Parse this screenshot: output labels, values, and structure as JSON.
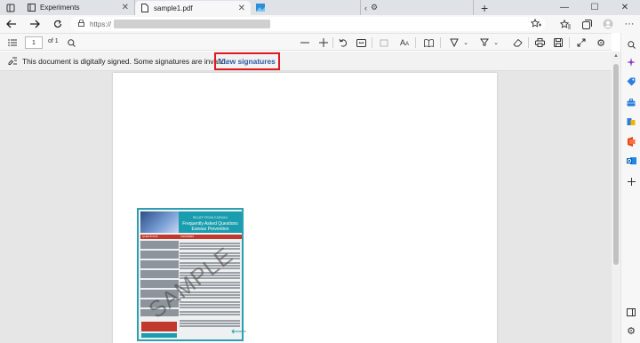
{
  "browser": {
    "tabs": [
      {
        "label": "Experiments",
        "active": false
      },
      {
        "label": "sample1.pdf",
        "active": true
      },
      {
        "label": "",
        "active": false
      }
    ],
    "new_tab_label": "+",
    "address": {
      "url_prefix": "https://"
    }
  },
  "pdf_toolbar": {
    "page_number": "1",
    "page_count": "of 1"
  },
  "signature_bar": {
    "message": "This document is digitally signed. Some signatures are invalid.",
    "link_label": "View signatures"
  },
  "document": {
    "brochure": {
      "title": "Frequently Asked Questions Earwax Prevention",
      "subtitle": "RELIEF FROM EARWAX",
      "questions_header": "QUESTIONS",
      "answers_header": "ANSWERS",
      "watermark": "SAMPLE"
    }
  },
  "colors": {
    "accent_red": "#e0191e",
    "link_blue": "#2b5aa6",
    "brochure_teal": "#1a9dae",
    "brochure_red": "#c0392b"
  }
}
